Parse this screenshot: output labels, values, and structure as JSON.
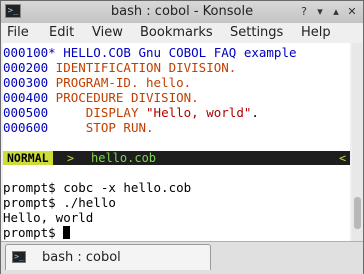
{
  "window": {
    "title": "bash : cobol - Konsole",
    "app_icon_glyph": ">_"
  },
  "title_buttons": {
    "help": "?",
    "minimize": "▾",
    "maximize": "▴",
    "close": "✕"
  },
  "menu": [
    "File",
    "Edit",
    "View",
    "Bookmarks",
    "Settings",
    "Help"
  ],
  "editor": {
    "lines": [
      {
        "num": "000100",
        "text": "* HELLO.COB Gnu COBOL FAQ example"
      },
      {
        "num": "000200",
        "text": " IDENTIFICATION DIVISION."
      },
      {
        "num": "000300",
        "text": " PROGRAM-ID. hello."
      },
      {
        "num": "000400",
        "text": " PROCEDURE DIVISION."
      },
      {
        "num": "000500",
        "indent": "     ",
        "keyword": "DISPLAY ",
        "string": "\"Hello, world\"",
        "rest": "."
      },
      {
        "num": "000600",
        "text": "     STOP RUN."
      }
    ],
    "status": {
      "mode": "NORMAL",
      "separator": ">",
      "filename": "hello.cob",
      "right_separator": "<"
    }
  },
  "shell": {
    "lines": [
      "prompt$ cobc -x hello.cob",
      "prompt$ ./hello",
      "Hello, world"
    ],
    "last_prompt": "prompt$ "
  },
  "tabs": [
    {
      "label": "bash : cobol",
      "icon": "terminal-icon"
    }
  ],
  "colors": {
    "line_number": "#0000c0",
    "keyword": "#c04000",
    "string": "#b00000",
    "status_mode": "#cddc39",
    "status_filename": "#7fd650"
  }
}
